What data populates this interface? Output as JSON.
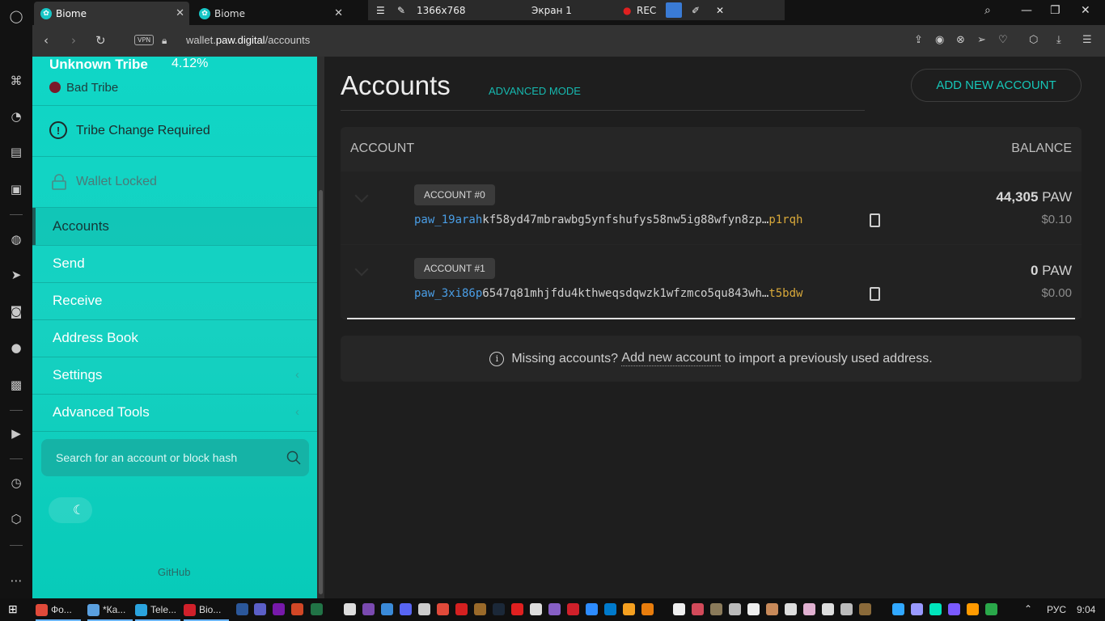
{
  "browser": {
    "tabs": [
      {
        "title": "Biome",
        "active": true
      },
      {
        "title": "Biome",
        "active": false
      }
    ],
    "url_prefix": "wallet.",
    "url_domain": "paw.digital",
    "url_path": "/accounts",
    "vpn_label": "VPN"
  },
  "recorder": {
    "resolution": "1366x768",
    "screen": "Экран 1",
    "rec_label": "REC"
  },
  "sidebar": {
    "tribe_name": "Unknown Tribe",
    "tribe_percent": "4.12%",
    "tribe_status": "Bad Tribe",
    "tribe_status_color": "#7a1a2a",
    "change_required": "Tribe Change Required",
    "wallet_status": "Wallet Locked",
    "nav": [
      {
        "label": "Accounts",
        "active": true
      },
      {
        "label": "Send"
      },
      {
        "label": "Receive"
      },
      {
        "label": "Address Book"
      },
      {
        "label": "Settings",
        "has_submenu": true
      },
      {
        "label": "Advanced Tools",
        "has_submenu": true
      }
    ],
    "search_placeholder": "Search for an account or block hash",
    "github_label": "GitHub"
  },
  "main": {
    "title": "Accounts",
    "advanced_mode": "ADVANCED MODE",
    "add_account": "ADD NEW ACCOUNT",
    "col_account": "ACCOUNT",
    "col_balance": "BALANCE",
    "accounts": [
      {
        "label": "ACCOUNT #0",
        "addr_prefix": "paw_19arah",
        "addr_middle": "kf58yd47mbrawbg5ynfshufys58nw5ig88wfyn8zp…",
        "addr_suffix": "p1rqh",
        "balance": "44,305",
        "unit": "PAW",
        "fiat": "$0.10"
      },
      {
        "label": "ACCOUNT #1",
        "addr_prefix": "paw_3xi86p",
        "addr_middle": "6547q81mhjfdu4kthweqsdqwzk1wfzmco5qu843wh…",
        "addr_suffix": "t5bdw",
        "balance": "0",
        "unit": "PAW",
        "fiat": "$0.00"
      }
    ],
    "missing_pre": "Missing accounts?",
    "missing_link": "Add new account",
    "missing_post": "to import a previously used address."
  },
  "taskbar": {
    "apps": [
      {
        "label": "Фо...",
        "color": "#e04a3a"
      },
      {
        "label": "*Ка...",
        "color": "#5aa0e0"
      },
      {
        "label": "Tele...",
        "color": "#2aa3de"
      },
      {
        "label": "Bio...",
        "color": "#d0202a"
      }
    ],
    "language": "РУС",
    "time": "9:04"
  }
}
